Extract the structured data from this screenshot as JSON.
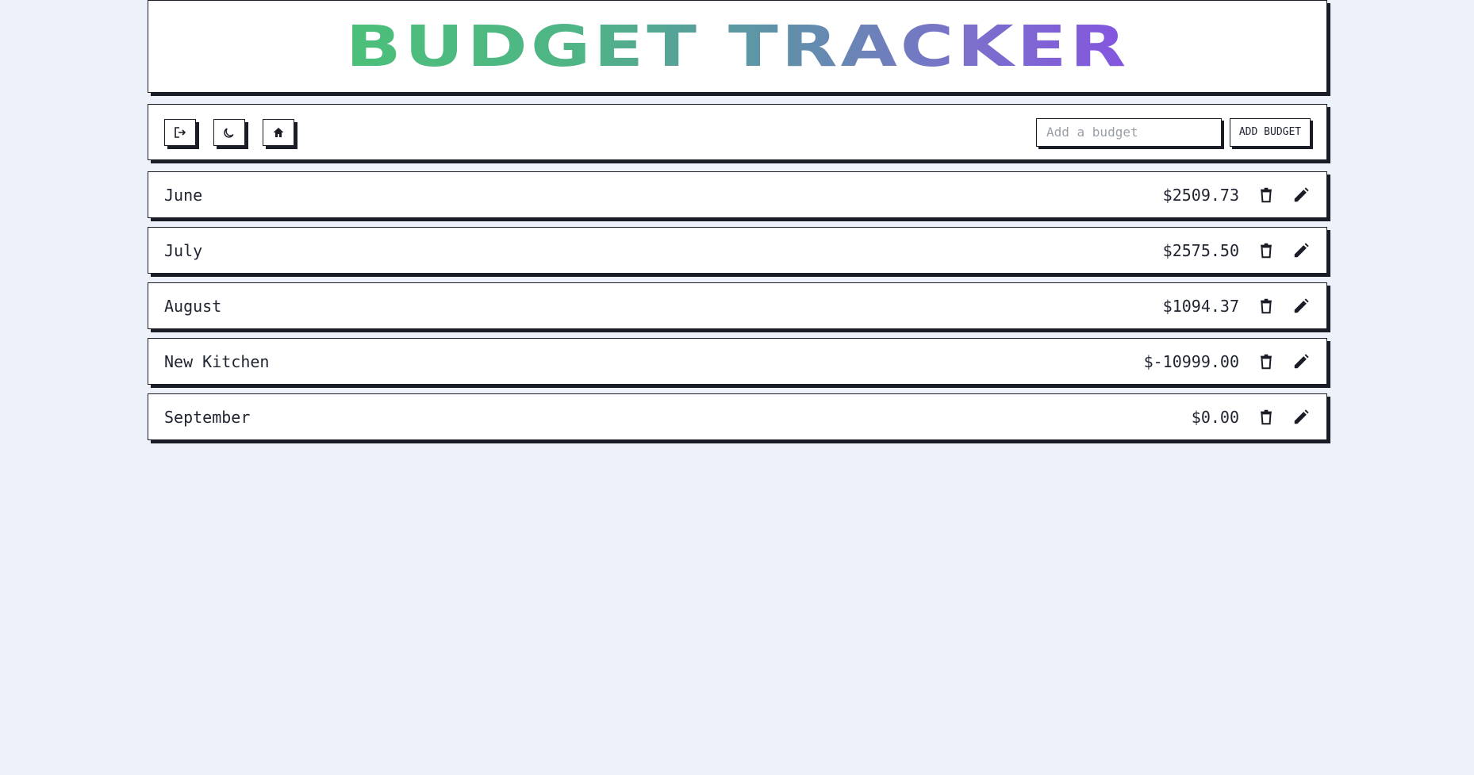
{
  "header": {
    "title": "BUDGET TRACKER"
  },
  "toolbar": {
    "buttons": [
      {
        "icon": "logout-icon"
      },
      {
        "icon": "moon-icon"
      },
      {
        "icon": "home-icon"
      }
    ],
    "input_placeholder": "Add a budget",
    "input_value": "",
    "add_label": "ADD BUDGET"
  },
  "budgets": [
    {
      "name": "June",
      "amount": "$2509.73"
    },
    {
      "name": "July",
      "amount": "$2575.50"
    },
    {
      "name": "August",
      "amount": "$1094.37"
    },
    {
      "name": "New Kitchen",
      "amount": "$-10999.00"
    },
    {
      "name": "September",
      "amount": "$0.00"
    }
  ],
  "colors": {
    "background": "#edf2fa",
    "border": "#1a1d26",
    "title_gradient_start": "#4cc07a",
    "title_gradient_end": "#8455e0"
  }
}
